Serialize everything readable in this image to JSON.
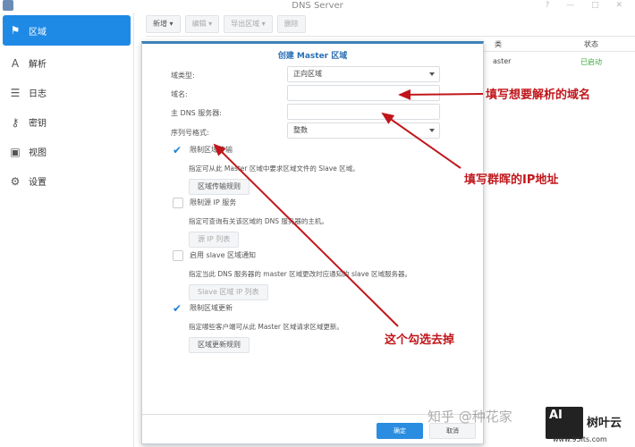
{
  "window": {
    "title": "DNS Server",
    "controls": "? — □ ✕"
  },
  "sidebar": {
    "items": [
      {
        "label": "区域",
        "icon": "flag-icon",
        "glyph": "⚑",
        "active": true
      },
      {
        "label": "解析",
        "icon": "resolve-icon",
        "glyph": "A"
      },
      {
        "label": "日志",
        "icon": "log-icon",
        "glyph": "☰"
      },
      {
        "label": "密钥",
        "icon": "key-icon",
        "glyph": "⚷"
      },
      {
        "label": "视图",
        "icon": "view-icon",
        "glyph": "▣"
      },
      {
        "label": "设置",
        "icon": "gear-icon",
        "glyph": "⚙"
      }
    ]
  },
  "toolbar": {
    "new": "新增 ▾",
    "edit": "编辑 ▾",
    "export": "导出区域 ▾",
    "delete": "删除"
  },
  "grid": {
    "col_type": "类",
    "col_status": "状态",
    "row_type": "aster",
    "row_status": "已启动"
  },
  "dialog": {
    "title": "创建 Master 区域",
    "domain_type_label": "域类型:",
    "domain_type_value": "正向区域",
    "domain_name_label": "域名:",
    "domain_name_value": "",
    "primary_dns_label": "主 DNS 服务器:",
    "primary_dns_value": "",
    "serial_label": "序列号格式:",
    "serial_value": "整数",
    "limit_transfer": {
      "label": "限制区域传输",
      "checked": true,
      "desc": "指定可从此 Master 区域中要求区域文件的 Slave 区域。",
      "button": "区域传输规则"
    },
    "limit_source_ip": {
      "label": "限制源 IP 服务",
      "checked": false,
      "desc": "指定可查询有关该区域的 DNS 服务器的主机。",
      "button": "源 IP 列表"
    },
    "slave_notify": {
      "label": "启用 slave 区域通知",
      "checked": false,
      "desc": "指定当此 DNS 服务器的 master 区域更改时应通知的 slave 区域服务器。",
      "button": "Slave 区域 IP 列表"
    },
    "limit_update": {
      "label": "限制区域更新",
      "checked": true,
      "desc": "指定哪些客户端可从此 Master 区域请求区域更新。",
      "button": "区域更新规则"
    },
    "ok": "确定",
    "cancel": "取消"
  },
  "annotations": {
    "a1": "填写想要解析的域名",
    "a2": "填写群晖的IP地址",
    "a3": "这个勾选去掉",
    "color": "#c0161b"
  },
  "watermark": {
    "text": "知乎 @种花家",
    "logo": "AI",
    "brand": "树叶云",
    "url": "www.95its.com"
  }
}
